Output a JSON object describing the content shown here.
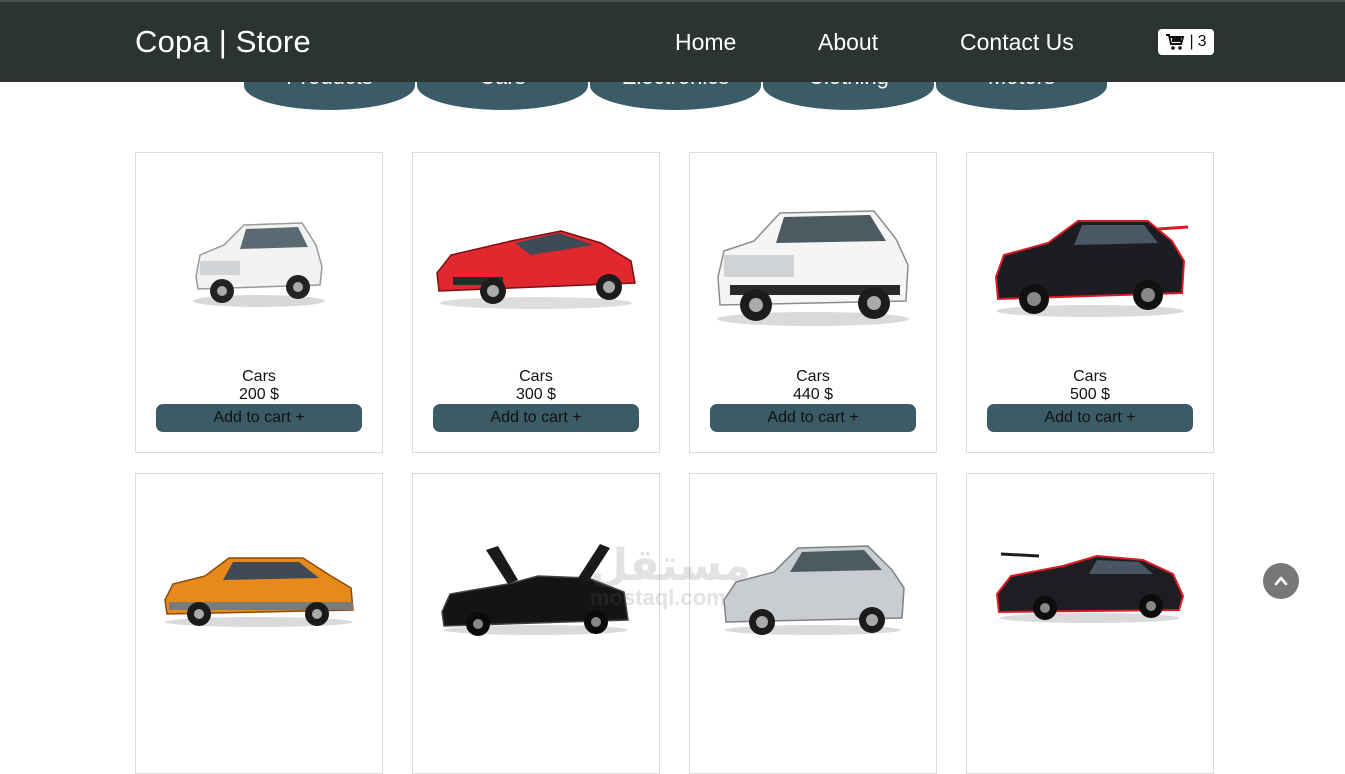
{
  "navbar": {
    "brand": "Copa | Store",
    "links": [
      "Home",
      "About",
      "Contact Us"
    ],
    "cart": {
      "icon": "cart-icon",
      "separator": "|",
      "count": "3"
    }
  },
  "tabs": [
    "Products",
    "Cars",
    "Electronics",
    "Clothing",
    "Motors"
  ],
  "products": [
    {
      "category": "Cars",
      "price": "200 $",
      "button": "Add to cart +",
      "image": "white-suv"
    },
    {
      "category": "Cars",
      "price": "300 $",
      "button": "Add to cart +",
      "image": "red-sports-car"
    },
    {
      "category": "Cars",
      "price": "440 $",
      "button": "Add to cart +",
      "image": "white-suv"
    },
    {
      "category": "Cars",
      "price": "500 $",
      "button": "Add to cart +",
      "image": "black-sports-car"
    },
    {
      "image": "orange-suv"
    },
    {
      "image": "black-supercar"
    },
    {
      "image": "silver-sedan"
    },
    {
      "image": "black-lamborghini"
    }
  ],
  "watermark": {
    "text": "مستقل",
    "subtext": "mostaql.com"
  },
  "colors": {
    "navbar": "#2c3432",
    "accent": "#3b5c66",
    "scroll_button": "#777777"
  }
}
